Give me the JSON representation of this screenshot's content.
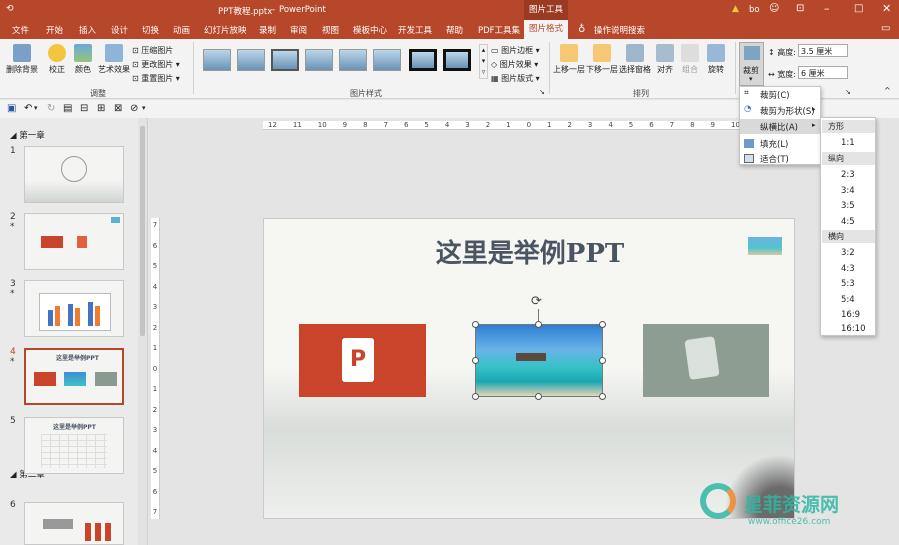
{
  "title": {
    "doc": "PPT教程.pptx",
    "app": "PowerPoint",
    "context_tab": "图片工具",
    "user": "bo"
  },
  "tabs": [
    "文件",
    "开始",
    "插入",
    "设计",
    "切换",
    "动画",
    "幻灯片放映",
    "录制",
    "审阅",
    "视图",
    "模板中心",
    "开发工具",
    "帮助",
    "PDF工具集",
    "图片格式",
    "操作说明搜索"
  ],
  "ribbon": {
    "adjust": {
      "remove_bg": "删除背景",
      "correct": "校正",
      "color": "颜色",
      "art": "艺术效果",
      "compress": "压缩图片",
      "change": "更改图片",
      "reset": "重置图片",
      "label": "调整"
    },
    "styles": {
      "border": "图片边框",
      "effect": "图片效果",
      "layout": "图片版式",
      "label": "图片样式"
    },
    "arrange": {
      "forward": "上移一层",
      "backward": "下移一层",
      "pane": "选择窗格",
      "align": "对齐",
      "group": "组合",
      "rotate": "旋转",
      "label": "排列"
    },
    "size": {
      "crop": "裁剪",
      "height_label": "高度:",
      "height": "3.5 厘米",
      "width_label": "宽度:",
      "width": "6 厘米"
    }
  },
  "sections": {
    "chapter1": "第一章",
    "chapter2": "第二章"
  },
  "slides": [
    {
      "num": "1",
      "star": ""
    },
    {
      "num": "2",
      "star": "*"
    },
    {
      "num": "3",
      "star": "*"
    },
    {
      "num": "4",
      "star": "*",
      "title": "这里是举例PPT"
    },
    {
      "num": "5",
      "star": "",
      "title": "这里是举例PPT"
    },
    {
      "num": "6",
      "star": ""
    }
  ],
  "ruler_h": [
    "12",
    "11",
    "10",
    "9",
    "8",
    "7",
    "6",
    "5",
    "4",
    "3",
    "2",
    "1",
    "0",
    "1",
    "2",
    "3",
    "4",
    "5",
    "6",
    "7",
    "8",
    "9",
    "10",
    "11",
    "12"
  ],
  "ruler_v": [
    "7",
    "6",
    "5",
    "4",
    "3",
    "2",
    "1",
    "0",
    "1",
    "2",
    "3",
    "4",
    "5",
    "6",
    "7"
  ],
  "slide": {
    "title": "这里是举例PPT"
  },
  "crop_menu": {
    "crop": "裁剪(C)",
    "crop_shape": "裁剪为形状(S)",
    "aspect": "纵横比(A)",
    "fill": "填充(L)",
    "fit": "适合(T)"
  },
  "aspect_menu": {
    "square_hdr": "方形",
    "square": [
      "1:1"
    ],
    "portrait_hdr": "纵向",
    "portrait": [
      "2:3",
      "3:4",
      "3:5",
      "4:5"
    ],
    "landscape_hdr": "横向",
    "landscape": [
      "3:2",
      "4:3",
      "5:3",
      "5:4",
      "16:9",
      "16:10"
    ]
  },
  "watermark": {
    "cn": "星菲资源网",
    "url": "www.office26.com"
  },
  "colors": {
    "accent": "#b7472a",
    "ppt_red": "#c9442a",
    "sea": "#3fb3c9"
  }
}
